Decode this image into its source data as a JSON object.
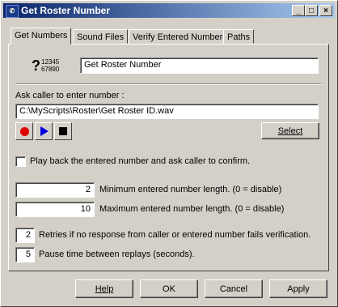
{
  "window": {
    "title": "Get Roster Number",
    "minimize": "_",
    "maximize": "□",
    "close": "×"
  },
  "tabs": [
    {
      "label": "Get Numbers",
      "active": true
    },
    {
      "label": "Sound Files",
      "active": false
    },
    {
      "label": "Verify Entered Number",
      "active": false
    },
    {
      "label": "Paths",
      "active": false
    }
  ],
  "header": {
    "icon_glyph": "?",
    "icon_digits_top": "12345",
    "icon_digits_bottom": "67890",
    "name_value": "Get Roster Number"
  },
  "prompt": {
    "label": "Ask caller to enter number :",
    "file_path": "C:\\MyScripts\\Roster\\Get Roster ID.wav",
    "select_label": "Select"
  },
  "media": {
    "record_icon": "record-icon",
    "play_icon": "play-icon",
    "stop_icon": "stop-icon"
  },
  "confirm": {
    "label": "Play back the entered number and ask caller to confirm.",
    "checked": false
  },
  "lengths": {
    "min_value": "2",
    "min_label": "Minimum entered number length. (0 = disable)",
    "max_value": "10",
    "max_label": "Maximum entered number length.  (0 = disable)"
  },
  "retries": {
    "value": "2",
    "label": "Retries if no response from caller or entered number fails verification."
  },
  "pause": {
    "value": "5",
    "label": "Pause time between replays (seconds)."
  },
  "footer": {
    "help": "Help",
    "ok": "OK",
    "cancel": "Cancel",
    "apply": "Apply"
  },
  "colors": {
    "title_start": "#0a246a",
    "title_end": "#a6caf0",
    "record": "#e00000",
    "play": "#0000e0",
    "stop": "#000000"
  }
}
